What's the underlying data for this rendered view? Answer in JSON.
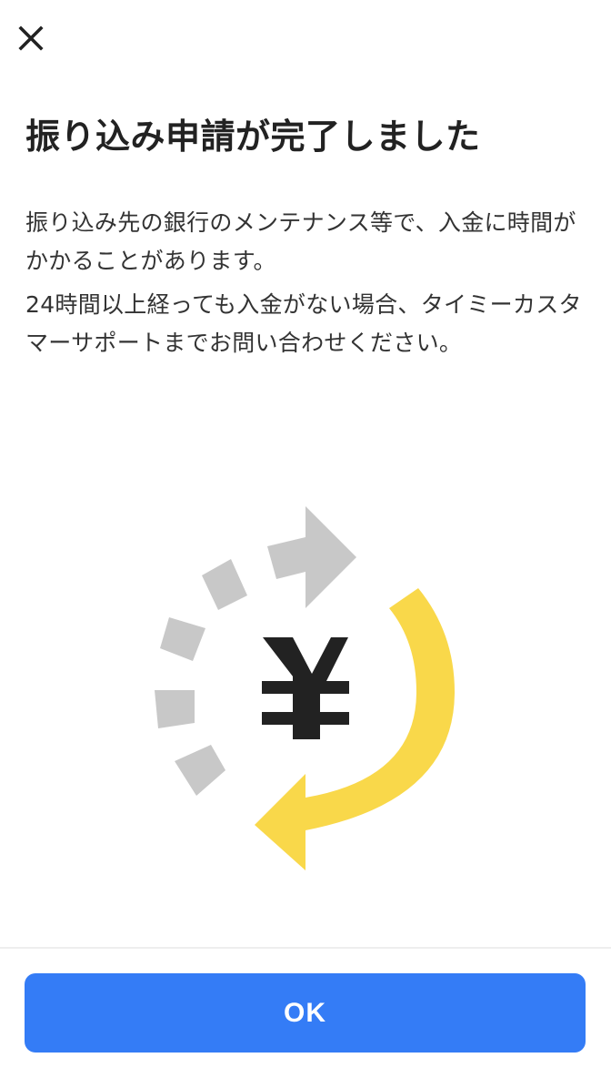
{
  "header": {
    "close_icon": "close-icon"
  },
  "main": {
    "title": "振り込み申請が完了しました",
    "paragraphs": [
      "振り込み先の銀行のメンテナンス等で、入金に時間がかかることがあります。",
      "24時間以上経っても入金がない場合、タイミーカスタマーサポートまでお問い合わせください。"
    ],
    "illustration": {
      "symbol": "¥",
      "icon": "yen-exchange-icon",
      "colors": {
        "yellow": "#f9d84a",
        "gray": "#c8c8c8",
        "symbol": "#222222"
      }
    }
  },
  "footer": {
    "ok_label": "OK",
    "button_color": "#347cf6"
  }
}
